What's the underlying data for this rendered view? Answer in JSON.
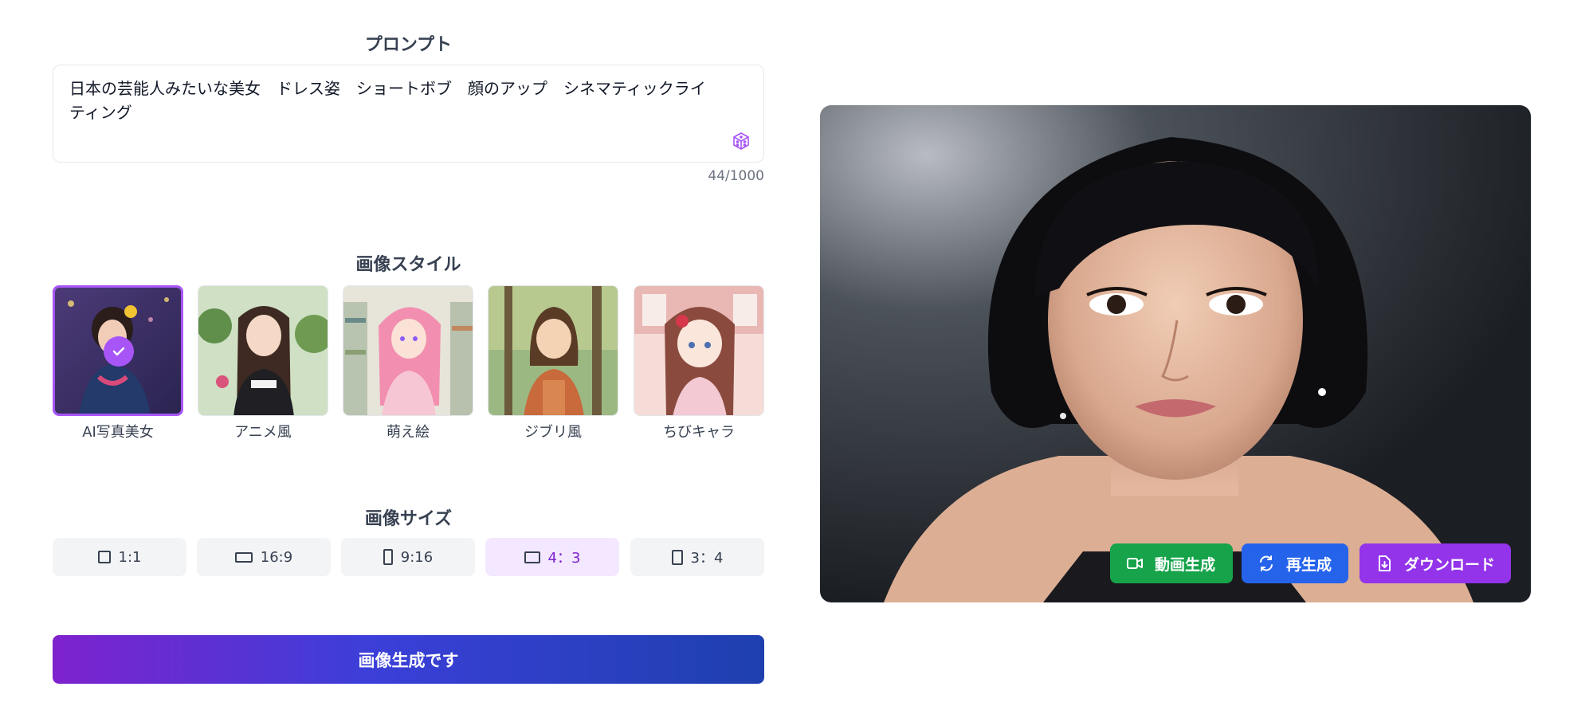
{
  "prompt": {
    "title": "プロンプト",
    "value": "日本の芸能人みたいな美女　ドレス姿　ショートボブ　顔のアップ　シネマティックライティング",
    "char_count": "44/1000"
  },
  "style": {
    "title": "画像スタイル",
    "items": [
      {
        "label": "AI写真美女",
        "selected": true
      },
      {
        "label": "アニメ風",
        "selected": false
      },
      {
        "label": "萌え絵",
        "selected": false
      },
      {
        "label": "ジブリ風",
        "selected": false
      },
      {
        "label": "ちびキャラ",
        "selected": false
      }
    ]
  },
  "size": {
    "title": "画像サイズ",
    "options": [
      {
        "label": "1:1",
        "active": false
      },
      {
        "label": "16:9",
        "active": false
      },
      {
        "label": "9:16",
        "active": false
      },
      {
        "label": "4：3",
        "active": true
      },
      {
        "label": "3：4",
        "active": false
      }
    ]
  },
  "generate_label": "画像生成です",
  "preview": {
    "actions": {
      "video": "動画生成",
      "regenerate": "再生成",
      "download": "ダウンロード"
    }
  },
  "colors": {
    "accent": "#a855f7",
    "video": "#16a34a",
    "regenerate": "#2563eb",
    "download": "#9333ea"
  }
}
